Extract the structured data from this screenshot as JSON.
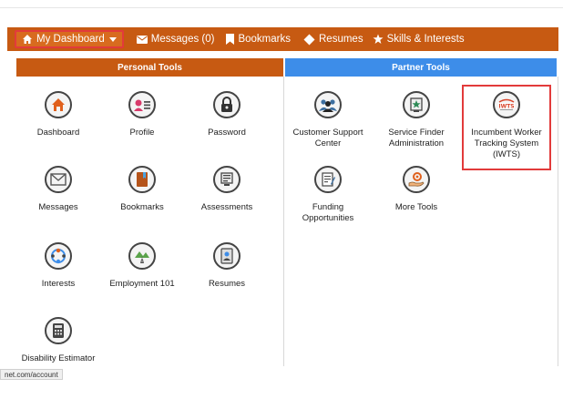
{
  "nav": {
    "dashboard": "My Dashboard",
    "messages": "Messages (0)",
    "bookmarks": "Bookmarks",
    "resumes": "Resumes",
    "skills": "Skills & Interests"
  },
  "sections": {
    "personal": "Personal Tools",
    "partner": "Partner Tools"
  },
  "personal_tools": [
    {
      "label": "Dashboard",
      "icon": "home-icon"
    },
    {
      "label": "Profile",
      "icon": "profile-card-icon"
    },
    {
      "label": "Password",
      "icon": "lock-icon"
    },
    {
      "label": "Messages",
      "icon": "envelope-icon"
    },
    {
      "label": "Bookmarks",
      "icon": "bookmark-book-icon"
    },
    {
      "label": "Assessments",
      "icon": "assessment-monitor-icon"
    },
    {
      "label": "Interests",
      "icon": "interests-icon"
    },
    {
      "label": "Employment 101",
      "icon": "road-icon"
    },
    {
      "label": "Resumes",
      "icon": "resume-person-icon"
    },
    {
      "label": "Disability Estimator",
      "icon": "calculator-icon"
    }
  ],
  "partner_tools": [
    {
      "label": "Customer Support Center",
      "icon": "people-group-icon"
    },
    {
      "label": "Service Finder Administration",
      "icon": "service-finder-icon"
    },
    {
      "label": "Incumbent Worker Tracking System (IWTS)",
      "icon": "iwts-logo-icon",
      "logo_text": "IWTS"
    },
    {
      "label": "Funding Opportunities",
      "icon": "grant-document-icon"
    },
    {
      "label": "More Tools",
      "icon": "hand-gear-icon"
    }
  ],
  "status_url": "net.com/account",
  "colors": {
    "nav": "#c75a12",
    "partner": "#3d8de9",
    "highlight": "#e23b3b"
  }
}
